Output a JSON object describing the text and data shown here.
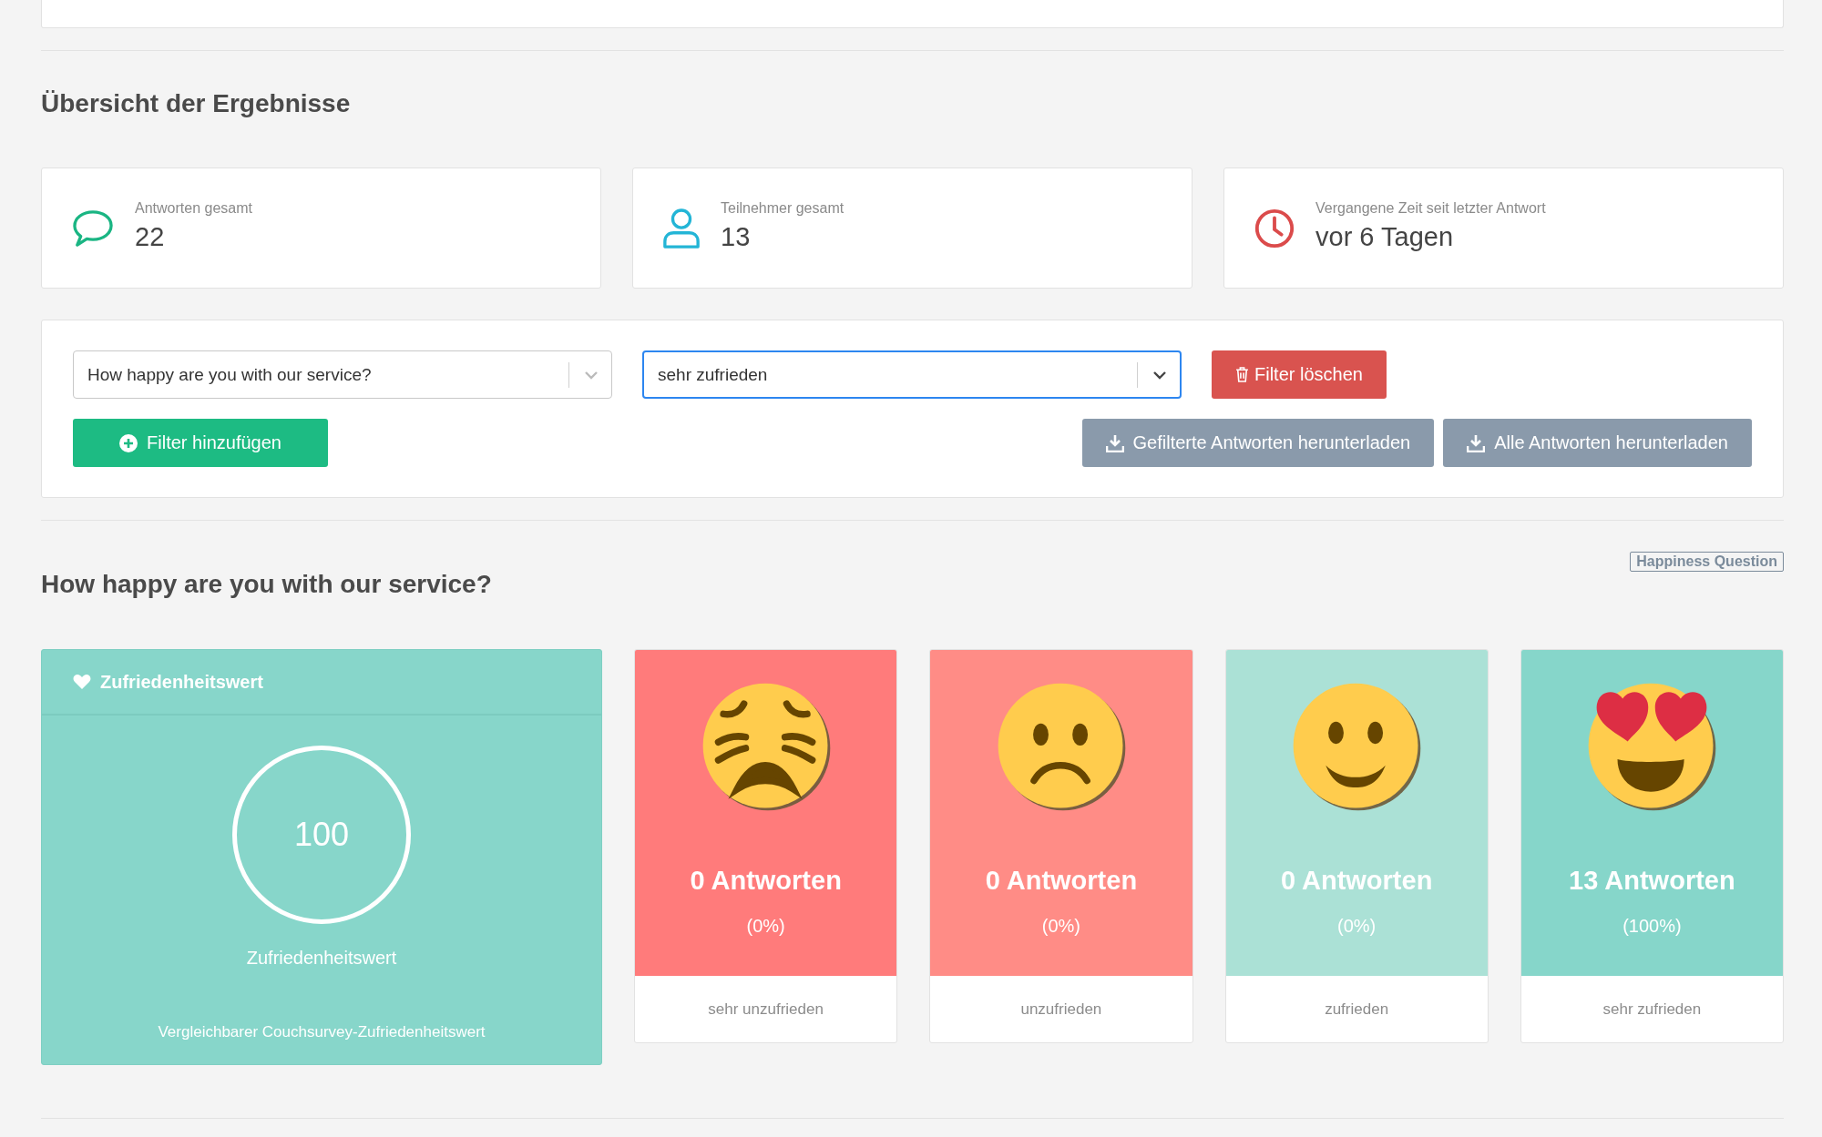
{
  "overview": {
    "title": "Übersicht der Ergebnisse",
    "stats": [
      {
        "label": "Antworten gesamt",
        "value": "22"
      },
      {
        "label": "Teilnehmer gesamt",
        "value": "13"
      },
      {
        "label": "Vergangene Zeit seit letzter Antwort",
        "value": "vor 6 Tagen"
      }
    ]
  },
  "filters": {
    "selects": [
      {
        "value": "How happy are you with our service?",
        "focused": false
      },
      {
        "value": "sehr zufrieden",
        "focused": true
      }
    ],
    "clear_button": "Filter löschen",
    "add_button": "Filter hinzufügen",
    "download_buttons": [
      "Gefilterte Antworten herunterladen",
      "Alle Antworten herunterladen"
    ]
  },
  "question": {
    "title": "How happy are you with our service?",
    "tag": "Happiness Question",
    "score": {
      "header": "Zufriedenheitswert",
      "value": "100",
      "caption": "Zufriedenheitswert",
      "footer": "Vergleichbarer Couchsurvey-Zufriedenheitswert"
    },
    "answers": [
      {
        "kind": "persevering",
        "color": "#ff7b7b",
        "count": "0 Antworten",
        "percent": "(0%)",
        "label": "sehr unzufrieden"
      },
      {
        "kind": "frowning",
        "color": "#ff8c86",
        "count": "0 Antworten",
        "percent": "(0%)",
        "label": "unzufrieden"
      },
      {
        "kind": "smiling",
        "color": "#abe1d6",
        "count": "0 Antworten",
        "percent": "(0%)",
        "label": "zufrieden"
      },
      {
        "kind": "heart-eyes",
        "color": "#86d6ca",
        "count": "13 Antworten",
        "percent": "(100%)",
        "label": "sehr zufrieden"
      }
    ]
  }
}
